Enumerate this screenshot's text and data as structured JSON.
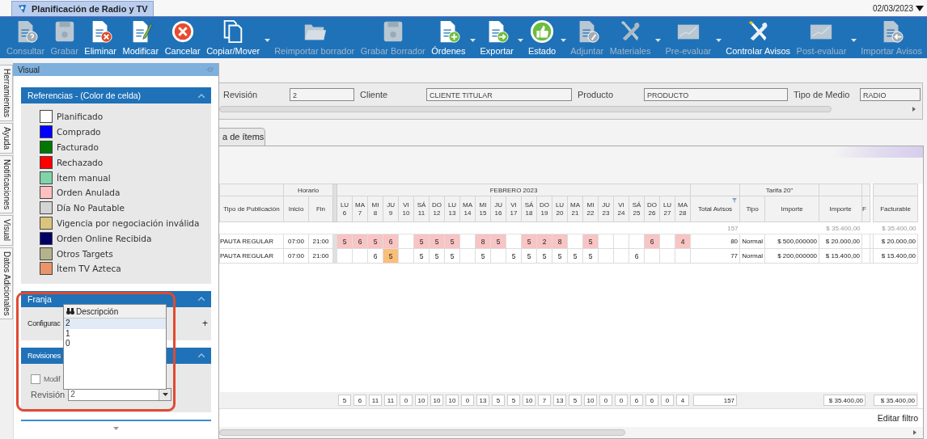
{
  "window": {
    "tab": "Planificación de Radio y TV",
    "date": "02/03/2023"
  },
  "toolbar": [
    {
      "label": "Consultar",
      "kind": "doc-question",
      "disabled": true,
      "dropdown": false
    },
    {
      "label": "Grabar",
      "kind": "floppy",
      "disabled": true,
      "dropdown": false
    },
    {
      "label": "Eliminar",
      "kind": "doc-x",
      "disabled": false,
      "dropdown": false
    },
    {
      "label": "Modificar",
      "kind": "doc-pencil",
      "disabled": false,
      "dropdown": false
    },
    {
      "label": "Cancelar",
      "kind": "cancel",
      "disabled": false,
      "dropdown": false
    },
    {
      "label": "Copiar/Mover",
      "kind": "copy",
      "disabled": false,
      "dropdown": true
    },
    {
      "label": "Reimportar borrador",
      "kind": "folder",
      "disabled": true,
      "dropdown": false
    },
    {
      "label": "Grabar Borrador",
      "kind": "floppy",
      "disabled": true,
      "dropdown": false
    },
    {
      "label": "Órdenes",
      "kind": "doc-plus",
      "disabled": false,
      "dropdown": true
    },
    {
      "label": "Exportar",
      "kind": "doc-arrow",
      "disabled": false,
      "dropdown": true
    },
    {
      "label": "Estado",
      "kind": "thumb",
      "disabled": false,
      "dropdown": true
    },
    {
      "label": "Adjuntar",
      "kind": "doc-clip",
      "disabled": true,
      "dropdown": false
    },
    {
      "label": "Materiales",
      "kind": "tools",
      "disabled": true,
      "dropdown": true
    },
    {
      "label": "Pre-evaluar",
      "kind": "chart",
      "disabled": true,
      "dropdown": true
    },
    {
      "label": "Controlar Avisos",
      "kind": "tools",
      "disabled": false,
      "dropdown": false
    },
    {
      "label": "Post-evaluar",
      "kind": "chart",
      "disabled": true,
      "dropdown": true
    },
    {
      "label": "Importar Avisos",
      "kind": "doc-back",
      "disabled": true,
      "dropdown": false
    }
  ],
  "side_tabs": [
    "Herramientas",
    "Ayuda",
    "Notificaciones",
    "Visual",
    "Datos Adicionales"
  ],
  "panel": {
    "title": "Visual",
    "legend": {
      "title": "Referencias - (Color de celda)",
      "items": [
        {
          "label": "Planificado",
          "color": "#ffffff"
        },
        {
          "label": "Comprado",
          "color": "#0000ff"
        },
        {
          "label": "Facturado",
          "color": "#007800"
        },
        {
          "label": "Rechazado",
          "color": "#ff0000"
        },
        {
          "label": "Ítem manual",
          "color": "#80d4a8"
        },
        {
          "label": "Orden Anulada",
          "color": "#ffc0c0"
        },
        {
          "label": "Día No Pautable",
          "color": "#d4d4d4"
        },
        {
          "label": "Vigencia por negociación inválida",
          "color": "#dcc47c"
        },
        {
          "label": "Orden Online Recibida",
          "color": "#000066"
        },
        {
          "label": "Otros Targets",
          "color": "#b4b48c"
        },
        {
          "label": "Ítem TV Azteca",
          "color": "#e8956a"
        }
      ]
    },
    "franja": {
      "title": "Franja",
      "label": "Configurac",
      "add": "+"
    },
    "revisiones": {
      "title": "Revisiones",
      "checkbox": {
        "label": "Modif",
        "checked": false
      },
      "label": "Revisión",
      "value": "2"
    },
    "popup": {
      "header": "Descripción",
      "items": [
        {
          "label": "2",
          "selected": true
        },
        {
          "label": "1",
          "selected": false
        },
        {
          "label": "0",
          "selected": false
        }
      ]
    }
  },
  "form": [
    {
      "label": "Revisión",
      "value": "2"
    },
    {
      "label": "Cliente",
      "value": "CLIENTE TITULAR"
    },
    {
      "label": "Producto",
      "value": "PRODUCTO"
    },
    {
      "label": "Tipo de Medio",
      "value": "RADIO"
    }
  ],
  "grid": {
    "tab": "a de ítems",
    "tipo": "Tipo de Publicación",
    "horario": "Horario",
    "inicio": "Inicio",
    "fin": "Fin",
    "month": "FEBRERO 2023",
    "days": [
      {
        "dow": "LU",
        "day": "6"
      },
      {
        "dow": "MA",
        "day": "7"
      },
      {
        "dow": "MI",
        "day": "8"
      },
      {
        "dow": "JU",
        "day": "9"
      },
      {
        "dow": "VI",
        "day": "10"
      },
      {
        "dow": "SÁ",
        "day": "11"
      },
      {
        "dow": "DO",
        "day": "12"
      },
      {
        "dow": "LU",
        "day": "13"
      },
      {
        "dow": "MA",
        "day": "14"
      },
      {
        "dow": "MI",
        "day": "15"
      },
      {
        "dow": "JU",
        "day": "16"
      },
      {
        "dow": "VI",
        "day": "17"
      },
      {
        "dow": "SÁ",
        "day": "18"
      },
      {
        "dow": "DO",
        "day": "19"
      },
      {
        "dow": "LU",
        "day": "20"
      },
      {
        "dow": "MA",
        "day": "21"
      },
      {
        "dow": "MI",
        "day": "22"
      },
      {
        "dow": "JU",
        "day": "23"
      },
      {
        "dow": "VI",
        "day": "24"
      },
      {
        "dow": "SÁ",
        "day": "25"
      },
      {
        "dow": "DO",
        "day": "26"
      },
      {
        "dow": "LU",
        "day": "27"
      },
      {
        "dow": "MA",
        "day": "28"
      }
    ],
    "total": "Total Avisos",
    "tarifa": "Tarifa 20\"",
    "tarifa_tipo": "Tipo",
    "tarifa_importe": "Importe",
    "importe": "Importe",
    "cut": "F",
    "facturable": "Facturable",
    "summary": {
      "total": "157",
      "importe": "$ 35.400,00",
      "facturable": "$ 35.400,00"
    },
    "rows": [
      {
        "tipo": "PAUTA REGULAR",
        "inicio": "07:00",
        "fin": "21:00",
        "cells": [
          {
            "text": "5",
            "color": "#f8c4c4"
          },
          {
            "text": "6",
            "color": "#f8c4c4"
          },
          {
            "text": "5",
            "color": "#f8c4c4"
          },
          {
            "text": "6",
            "color": "#f8c4c4"
          },
          null,
          {
            "text": "5",
            "color": "#f8c4c4"
          },
          {
            "text": "5",
            "color": "#f8c4c4"
          },
          {
            "text": "5",
            "color": "#f8c4c4"
          },
          null,
          {
            "text": "8",
            "color": "#f8c4c4"
          },
          {
            "text": "5",
            "color": "#f8c4c4"
          },
          null,
          {
            "text": "5",
            "color": "#f8c4c4"
          },
          {
            "text": "2",
            "color": "#f8c4c4"
          },
          {
            "text": "8",
            "color": "#f8c4c4"
          },
          null,
          {
            "text": "5",
            "color": "#f8c4c4"
          },
          null,
          null,
          null,
          {
            "text": "6",
            "color": "#f8c4c4"
          },
          null,
          {
            "text": "4",
            "color": "#f8c4c4"
          }
        ],
        "total": "80",
        "tarifa_tipo": "Normal",
        "tarifa_importe": "$ 500,000000",
        "importe": "$ 20.000,00",
        "facturable": "$ 20.000,00"
      },
      {
        "tipo": "PAUTA REGULAR",
        "inicio": "07:00",
        "fin": "21:00",
        "cells": [
          null,
          null,
          {
            "text": "6",
            "color": "#ffffff"
          },
          {
            "text": "5",
            "color": "#f9bf7a"
          },
          null,
          {
            "text": "5",
            "color": "#ffffff"
          },
          {
            "text": "5",
            "color": "#ffffff"
          },
          {
            "text": "5",
            "color": "#ffffff"
          },
          null,
          {
            "text": "5",
            "color": "#ffffff"
          },
          null,
          {
            "text": "5",
            "color": "#ffffff"
          },
          {
            "text": "5",
            "color": "#ffffff"
          },
          {
            "text": "5",
            "color": "#ffffff"
          },
          {
            "text": "5",
            "color": "#ffffff"
          },
          {
            "text": "5",
            "color": "#ffffff"
          },
          {
            "text": "5",
            "color": "#ffffff"
          },
          null,
          null,
          {
            "text": "6",
            "color": "#ffffff"
          },
          null,
          null,
          null
        ],
        "total": "77",
        "tarifa_tipo": "Normal",
        "tarifa_importe": "$ 200,000000",
        "importe": "$ 15.400,00",
        "facturable": "$ 15.400,00"
      }
    ],
    "totals": {
      "days": [
        "5",
        "6",
        "11",
        "11",
        "0",
        "10",
        "10",
        "10",
        "0",
        "13",
        "5",
        "5",
        "10",
        "7",
        "13",
        "5",
        "10",
        "0",
        "0",
        "6",
        "6",
        "0",
        "4"
      ],
      "total": "157",
      "importe": "$ 35.400,00",
      "facturable": "$ 35.400,00"
    },
    "filter_link": "Editar filtro"
  }
}
